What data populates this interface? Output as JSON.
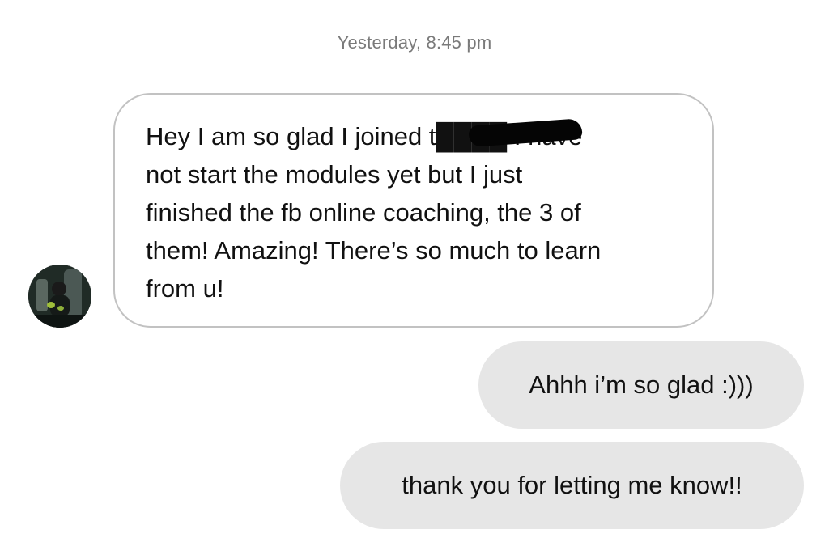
{
  "conversation": {
    "timestamp": "Yesterday, 8:45 pm",
    "incoming": {
      "avatar_icon": "user-avatar-photo",
      "text": "Hey I am so glad I joined t████ I have\nnot start the modules yet but I just\nfinished the fb online coaching, the 3 of\nthem! Amazing! There’s so much to learn\nfrom u!"
    },
    "outgoing": [
      {
        "text": "Ahhh i’m so glad :)))"
      },
      {
        "text": "thank you for letting me know!!"
      }
    ]
  },
  "colors": {
    "background": "#ffffff",
    "timestamp_text": "#7a7a7a",
    "incoming_border": "#c2c2c2",
    "outgoing_bg": "#e6e6e6",
    "text": "#111111"
  }
}
